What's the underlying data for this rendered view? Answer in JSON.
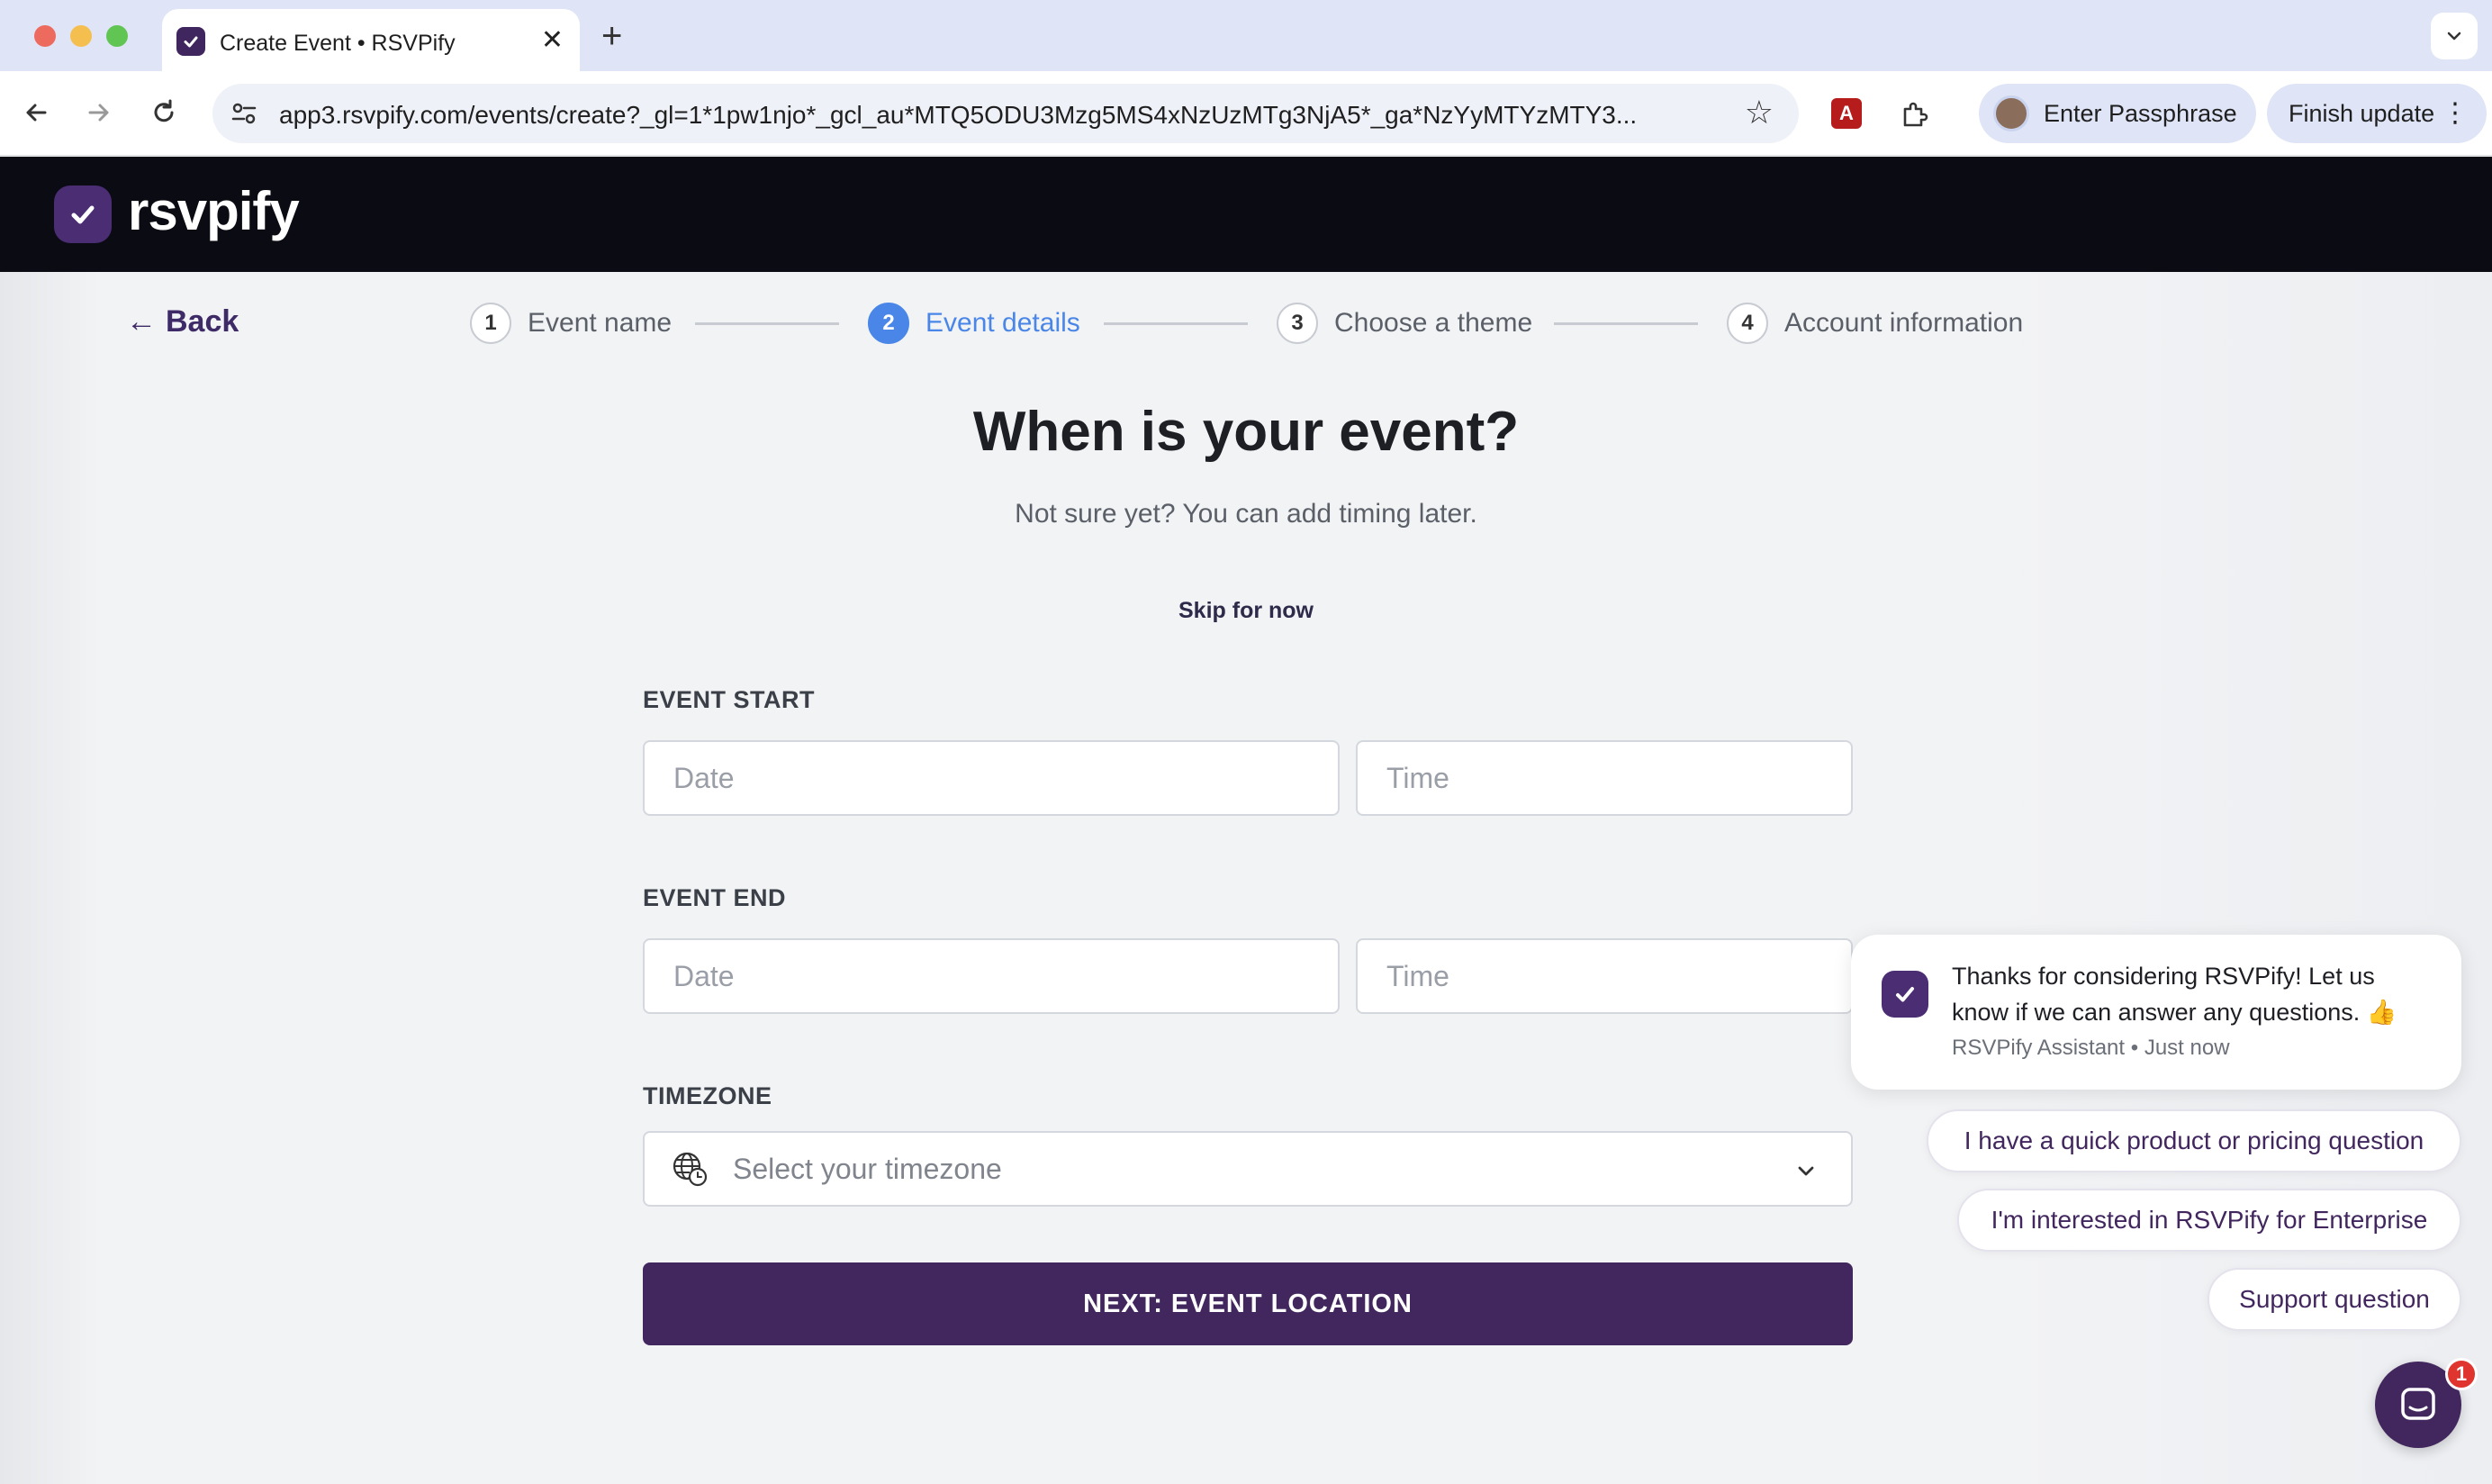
{
  "browser": {
    "tab_title": "Create Event • RSVPify",
    "tab_close": "✕",
    "new_tab": "+",
    "url": "app3.rsvpify.com/events/create?_gl=1*1pw1njo*_gcl_au*MTQ5ODU3Mzg5MS4xNzUzMTg3NjA5*_ga*NzYyMTYzMTY3...",
    "profile_chip": "Enter Passphrase",
    "update_chip": "Finish update",
    "pdf_ext_glyph": "A",
    "icons": [
      "back-icon",
      "forward-icon",
      "reload-icon",
      "site-settings-icon",
      "bookmark-star-icon",
      "pdf-extension-icon",
      "extensions-puzzle-icon",
      "more-menu-icon"
    ]
  },
  "app": {
    "logo_text": "rsvpify",
    "brand_color": "#42275e",
    "accent_color": "#4a86e8"
  },
  "nav": {
    "back_label": "Back",
    "back_arrow": "←"
  },
  "stepper": {
    "steps": [
      {
        "number": "1",
        "label": "Event name",
        "state": "inactive"
      },
      {
        "number": "2",
        "label": "Event details",
        "state": "active"
      },
      {
        "number": "3",
        "label": "Choose a theme",
        "state": "inactive"
      },
      {
        "number": "4",
        "label": "Account information",
        "state": "inactive"
      }
    ]
  },
  "form": {
    "heading": "When is your event?",
    "subheading": "Not sure yet? You can add timing later.",
    "skip_label": "Skip for now",
    "event_start": {
      "label": "EVENT START",
      "date_placeholder": "Date",
      "time_placeholder": "Time"
    },
    "event_end": {
      "label": "EVENT END",
      "date_placeholder": "Date",
      "time_placeholder": "Time"
    },
    "timezone": {
      "label": "TIMEZONE",
      "placeholder": "Select your timezone"
    },
    "next_button": "NEXT: EVENT LOCATION"
  },
  "chat": {
    "message": "Thanks for considering RSVPify! Let us know if we can answer any questions. 👍",
    "sender": "RSVPify Assistant",
    "separator": "•",
    "time": "Just now",
    "quick_replies": [
      "I have a quick product or pricing question",
      "I'm interested in RSVPify for Enterprise",
      "Support question"
    ],
    "unread_count": "1"
  }
}
